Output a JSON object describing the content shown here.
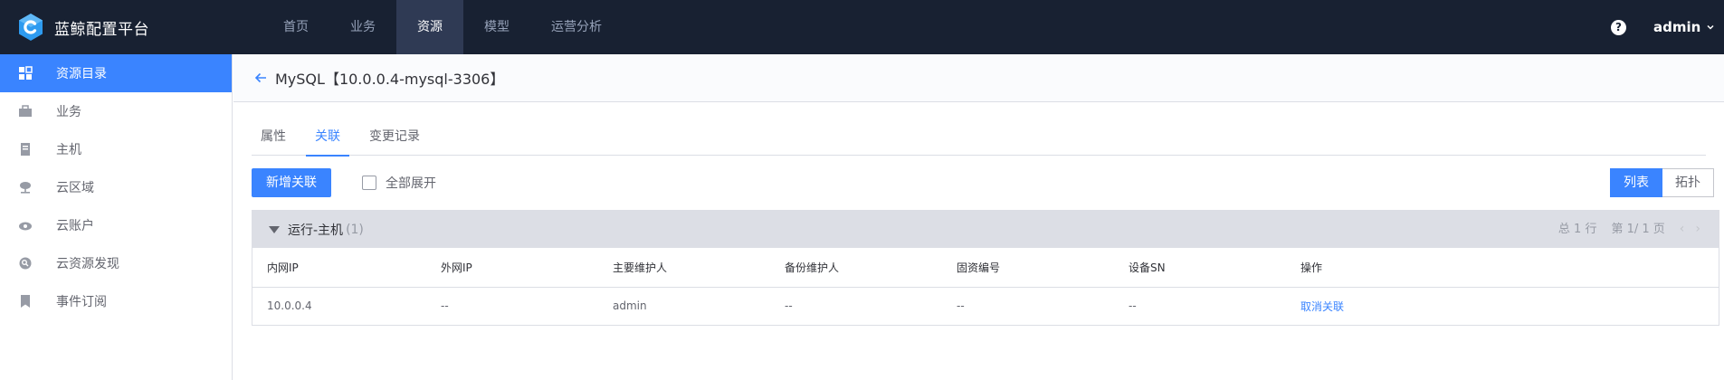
{
  "brand": {
    "name": "蓝鲸配置平台",
    "logo_icon": "bk-cmdb-logo-icon"
  },
  "nav": {
    "items": [
      {
        "label": "首页",
        "active": false
      },
      {
        "label": "业务",
        "active": false
      },
      {
        "label": "资源",
        "active": true
      },
      {
        "label": "模型",
        "active": false
      },
      {
        "label": "运营分析",
        "active": false
      }
    ],
    "help_glyph": "?",
    "user": "admin"
  },
  "sidebar": {
    "items": [
      {
        "label": "资源目录",
        "icon": "grid-icon",
        "active": true
      },
      {
        "label": "业务",
        "icon": "briefcase-icon",
        "active": false
      },
      {
        "label": "主机",
        "icon": "server-icon",
        "active": false
      },
      {
        "label": "云区域",
        "icon": "cloud-network-icon",
        "active": false
      },
      {
        "label": "云账户",
        "icon": "cloud-account-icon",
        "active": false
      },
      {
        "label": "云资源发现",
        "icon": "cloud-discovery-icon",
        "active": false
      },
      {
        "label": "事件订阅",
        "icon": "bookmark-icon",
        "active": false
      }
    ]
  },
  "page": {
    "title": "MySQL【10.0.0.4-mysql-3306】"
  },
  "tabs": [
    {
      "label": "属性",
      "active": false
    },
    {
      "label": "关联",
      "active": true
    },
    {
      "label": "变更记录",
      "active": false
    }
  ],
  "toolbar": {
    "add_label": "新增关联",
    "expand_all_label": "全部展开",
    "view_list_label": "列表",
    "view_topo_label": "拓扑"
  },
  "group": {
    "name": "运行-主机",
    "count": "(1)",
    "total_text": "总 1 行",
    "page_text": "第 1/ 1 页",
    "prev": "‹",
    "next": "›",
    "columns": [
      "内网IP",
      "外网IP",
      "主要维护人",
      "备份维护人",
      "固资编号",
      "设备SN",
      "操作"
    ],
    "rows": [
      {
        "cells": [
          "10.0.0.4",
          "--",
          "admin",
          "--",
          "--",
          "--"
        ],
        "action": "取消关联"
      }
    ]
  },
  "colors": {
    "topbar": "#182132",
    "accent": "#3a84ff",
    "nav_active": "#2f3a54"
  }
}
